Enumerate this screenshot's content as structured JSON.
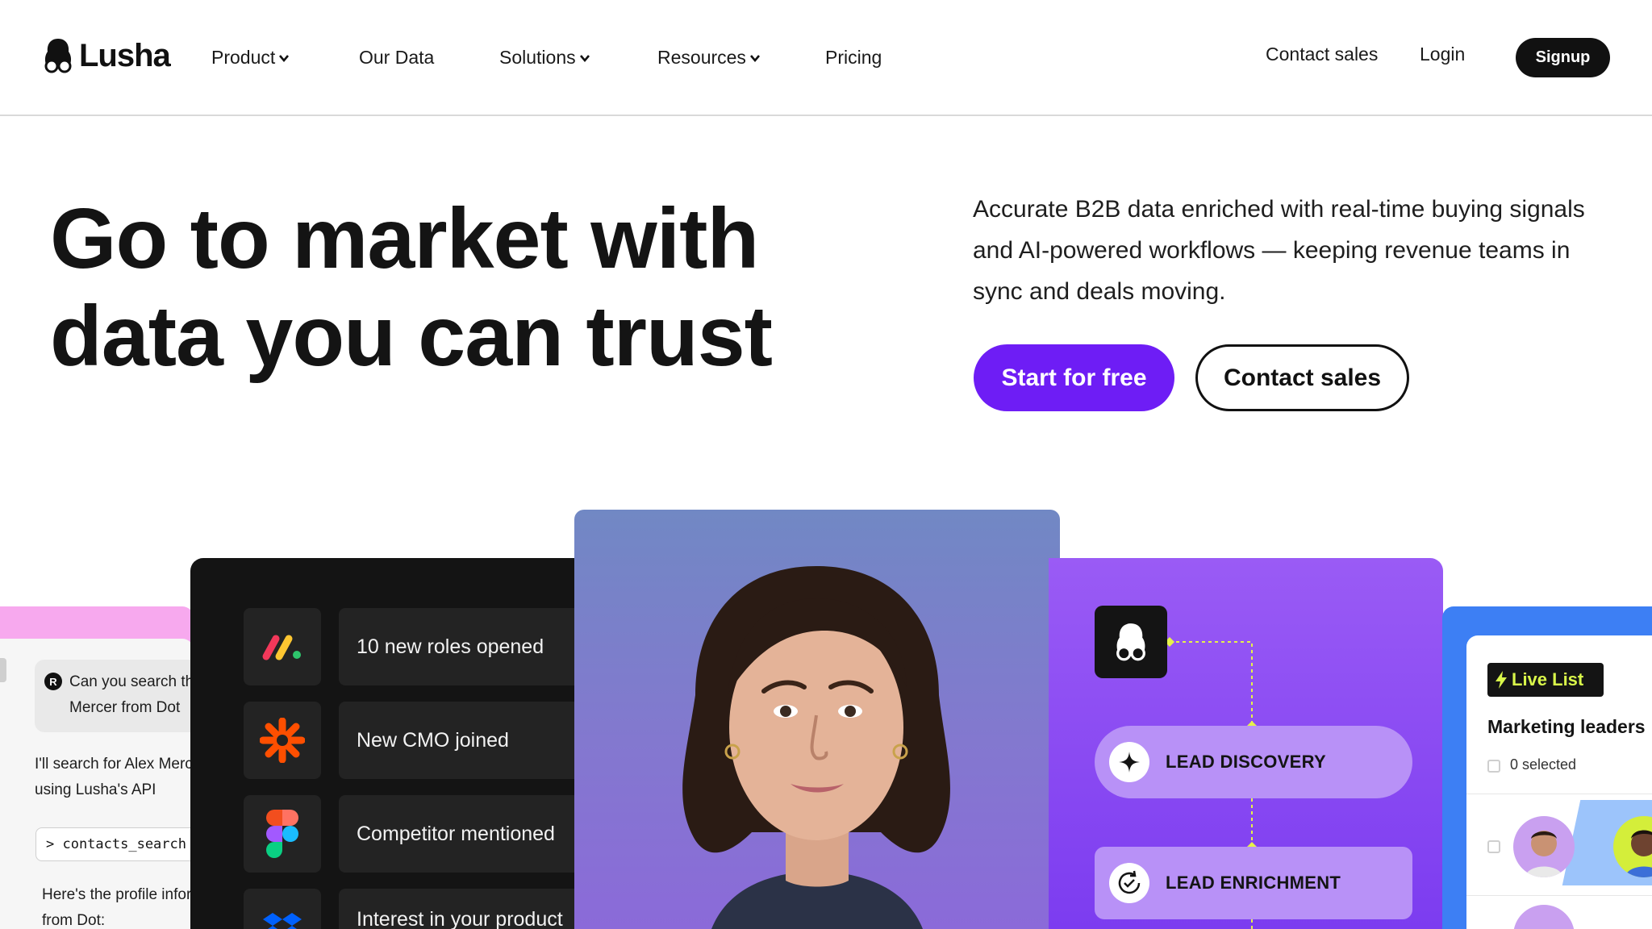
{
  "nav": {
    "brand": "Lusha",
    "items": [
      {
        "label": "Product",
        "has_menu": true
      },
      {
        "label": "Our Data",
        "has_menu": false
      },
      {
        "label": "Solutions",
        "has_menu": true
      },
      {
        "label": "Resources",
        "has_menu": true
      },
      {
        "label": "Pricing",
        "has_menu": false
      }
    ],
    "contact_sales": "Contact sales",
    "login": "Login",
    "signup": "Signup"
  },
  "hero": {
    "title_line1": "Go to market with",
    "title_line2": "data you can trust",
    "subtitle": "Accurate B2B data enriched with real-time buying signals and AI-powered workflows — keeping revenue teams in sync and deals moving.",
    "primary_cta": "Start for free",
    "secondary_cta": "Contact sales"
  },
  "chat_card": {
    "avatar_letter": "R",
    "user_message_line1": "Can you search th",
    "user_message_line2": "Mercer from Dot",
    "reply_line1": "I'll search for Alex Merce",
    "reply_line2": "using Lusha's API",
    "command": "> contacts_search  ✓",
    "result_line1": "Here's the profile infor",
    "result_line2": "from Dot:"
  },
  "signals_card": {
    "signals": [
      {
        "text": "10 new roles opened",
        "icon": "monday-logo-icon"
      },
      {
        "text": "New CMO joined",
        "icon": "zapier-asterisk-icon"
      },
      {
        "text": "Competitor mentioned",
        "icon": "figma-logo-icon"
      },
      {
        "text": "Interest in your product",
        "icon": "dropbox-logo-icon"
      }
    ]
  },
  "workflow_card": {
    "steps": [
      "LEAD DISCOVERY",
      "LEAD ENRICHMENT"
    ],
    "accent": "#e6f24a"
  },
  "list_card": {
    "badge": "Live List",
    "title": "Marketing leaders",
    "selected": "0 selected"
  },
  "colors": {
    "brand_purple": "#6e1df5",
    "dark": "#141414",
    "pink": "#f7a9ee",
    "blue": "#3d7ff4"
  }
}
